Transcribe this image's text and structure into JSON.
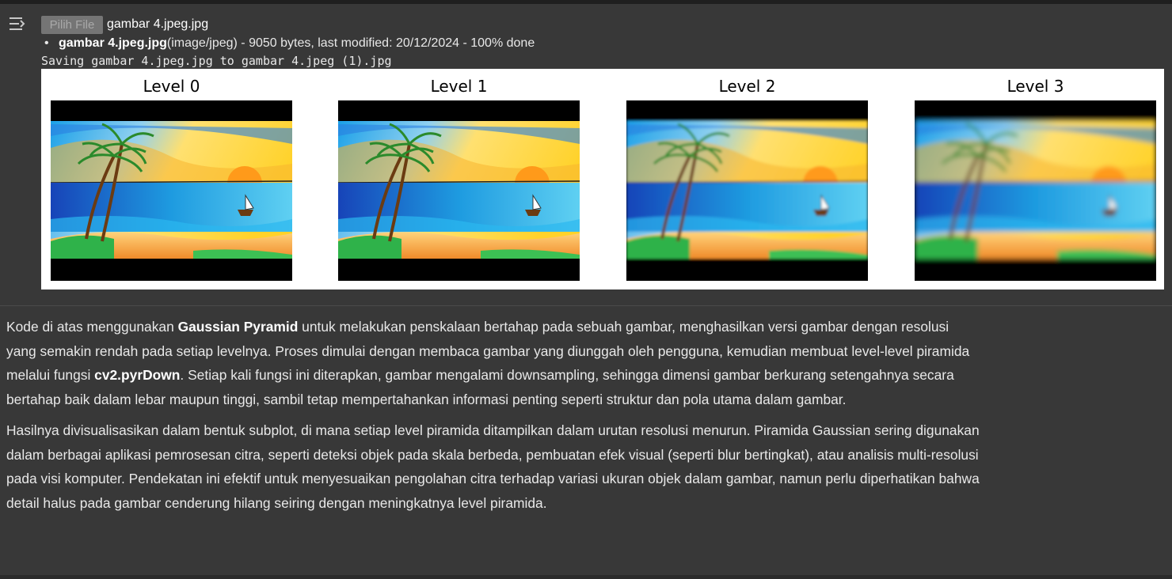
{
  "output": {
    "collapse_icon": "collapse-output-icon",
    "file_button_label": "Pilih File",
    "selected_file": "gambar 4.jpeg.jpg",
    "file_info": {
      "name": "gambar 4.jpeg.jpg",
      "details": "(image/jpeg) - 9050 bytes, last modified: 20/12/2024 - 100% done"
    },
    "saving_message": "Saving gambar 4.jpeg.jpg to gambar 4.jpeg (1).jpg"
  },
  "figure": {
    "panels": [
      {
        "title": "Level 0"
      },
      {
        "title": "Level 1"
      },
      {
        "title": "Level 2"
      },
      {
        "title": "Level 3"
      }
    ]
  },
  "text": {
    "p1": {
      "a": "Kode di atas menggunakan ",
      "b": "Gaussian Pyramid",
      "c": " untuk melakukan penskalaan bertahap pada sebuah gambar, menghasilkan versi gambar dengan resolusi yang semakin rendah pada setiap levelnya. Proses dimulai dengan membaca gambar yang diunggah oleh pengguna, kemudian membuat level-level piramida melalui fungsi ",
      "d": "cv2.pyrDown",
      "e": ". Setiap kali fungsi ini diterapkan, gambar mengalami downsampling, sehingga dimensi gambar berkurang setengahnya secara bertahap baik dalam lebar maupun tinggi, sambil tetap mempertahankan informasi penting seperti struktur dan pola utama dalam gambar."
    },
    "p2": "Hasilnya divisualisasikan dalam bentuk subplot, di mana setiap level piramida ditampilkan dalam urutan resolusi menurun. Piramida Gaussian sering digunakan dalam berbagai aplikasi pemrosesan citra, seperti deteksi objek pada skala berbeda, pembuatan efek visual (seperti blur bertingkat), atau analisis multi-resolusi pada visi komputer. Pendekatan ini efektif untuk menyesuaikan pengolahan citra terhadap variasi ukuran objek dalam gambar, namun perlu diperhatikan bahwa detail halus pada gambar cenderung hilang seiring dengan meningkatnya level piramida."
  }
}
